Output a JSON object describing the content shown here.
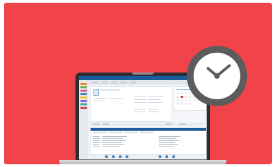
{
  "app": {
    "window_title": ""
  },
  "colors": {
    "background": "#f0434a",
    "app_blue": "#1d5c9c",
    "clock_rim": "#5c5c5e",
    "clock_face": "#ffffff"
  },
  "clock": {
    "icon": "clock-icon",
    "time": "10:10"
  }
}
